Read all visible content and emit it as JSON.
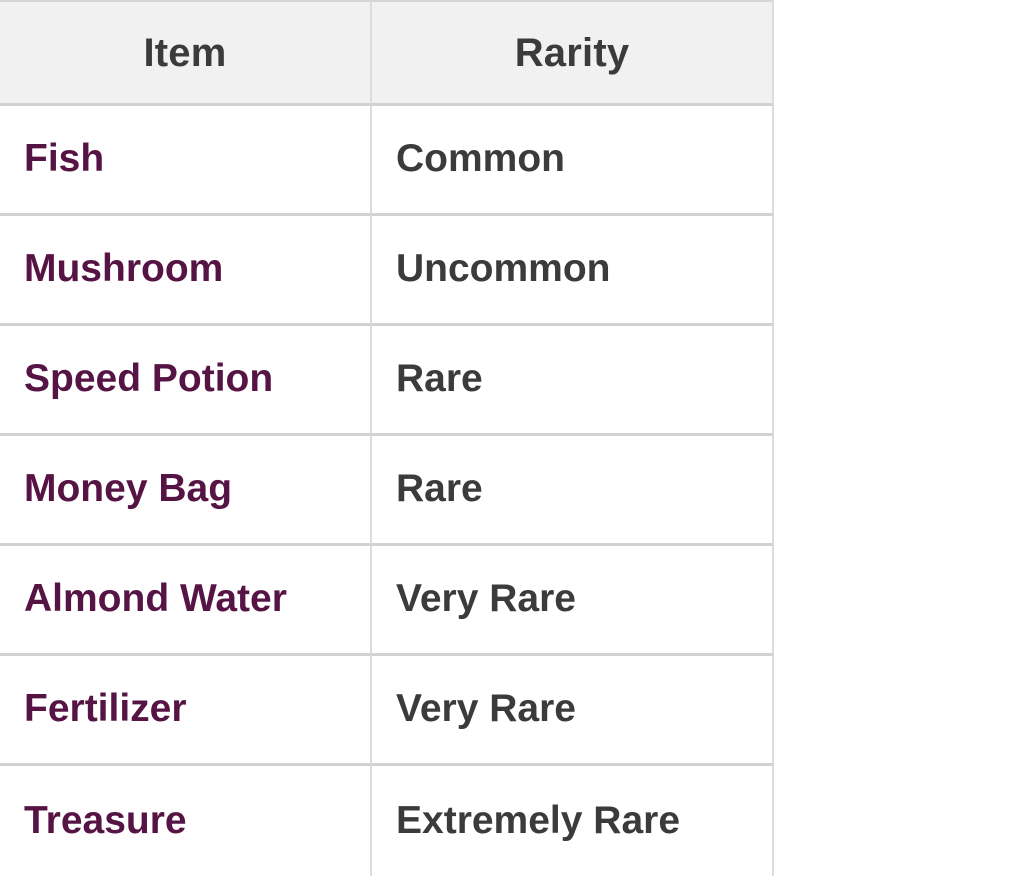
{
  "table": {
    "columns": [
      {
        "key": "item",
        "label": "Item",
        "align": "center"
      },
      {
        "key": "rarity",
        "label": "Rarity",
        "align": "center"
      }
    ],
    "rows": [
      {
        "item": "Fish",
        "rarity": "Common"
      },
      {
        "item": "Mushroom",
        "rarity": "Uncommon"
      },
      {
        "item": "Speed Potion",
        "rarity": "Rare"
      },
      {
        "item": "Money Bag",
        "rarity": "Rare"
      },
      {
        "item": "Almond Water",
        "rarity": "Very Rare"
      },
      {
        "item": "Fertilizer",
        "rarity": "Very Rare"
      },
      {
        "item": "Treasure",
        "rarity": "Extremely Rare"
      }
    ],
    "colors": {
      "header_background": "#f1f1f1",
      "header_text": "#3b3b3b",
      "item_text": "#561445",
      "rarity_text": "#3b3b3b",
      "border": "#d2d2d2",
      "cell_background": "#ffffff",
      "page_background": "#ffffff"
    }
  }
}
